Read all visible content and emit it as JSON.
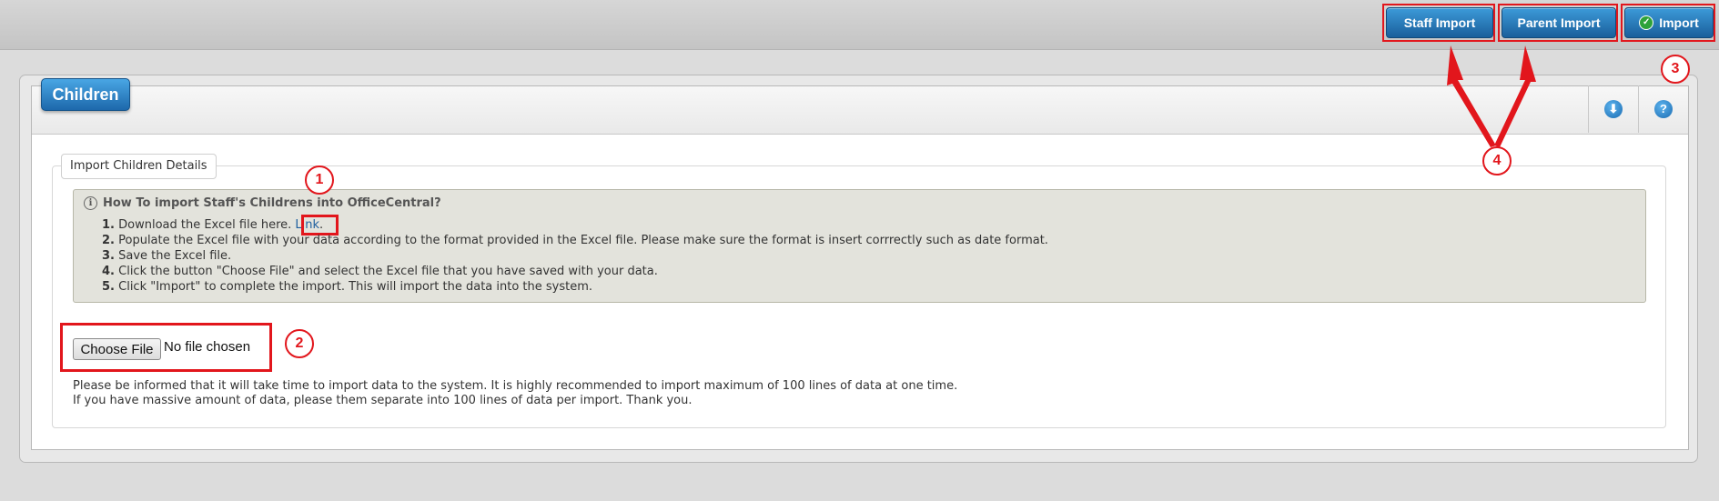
{
  "toolbar": {
    "staff_import": "Staff Import",
    "parent_import": "Parent Import",
    "import": "Import"
  },
  "panel": {
    "title": "Children",
    "download_icon": "download-icon",
    "help_icon": "help-icon",
    "help_glyph": "?",
    "download_glyph": "⬇"
  },
  "section": {
    "legend": "Import Children Details",
    "info_title": "How To import Staff's Childrens into OfficeCentral?",
    "steps": [
      {
        "num": "1.",
        "text": "Download the Excel file here. ",
        "link": "Link",
        "suffix": "."
      },
      {
        "num": "2.",
        "text": "Populate the Excel file with your data according to the format provided in the Excel file. Please make sure the format is insert corrrectly such as date format."
      },
      {
        "num": "3.",
        "text": "Save the Excel file."
      },
      {
        "num": "4.",
        "text": "Click the button \"Choose File\" and select the Excel file that you have saved with your data."
      },
      {
        "num": "5.",
        "text": "Click \"Import\" to complete the import. This will import the data into the system."
      }
    ]
  },
  "file_input": {
    "button_label": "Choose File",
    "status": "No file chosen"
  },
  "notes": [
    "Please be informed that it will take time to import data to the system. It is highly recommended to import maximum of 100 lines of data at one time.",
    "If you have massive amount of data, please them separate into 100 lines of data per import. Thank you."
  ],
  "annotations": {
    "one": "1",
    "two": "2",
    "three": "3",
    "four": "4"
  },
  "colors": {
    "accent": "#1d68ab",
    "annotation_red": "#e2161c",
    "info_bg": "#e3e3dc"
  }
}
